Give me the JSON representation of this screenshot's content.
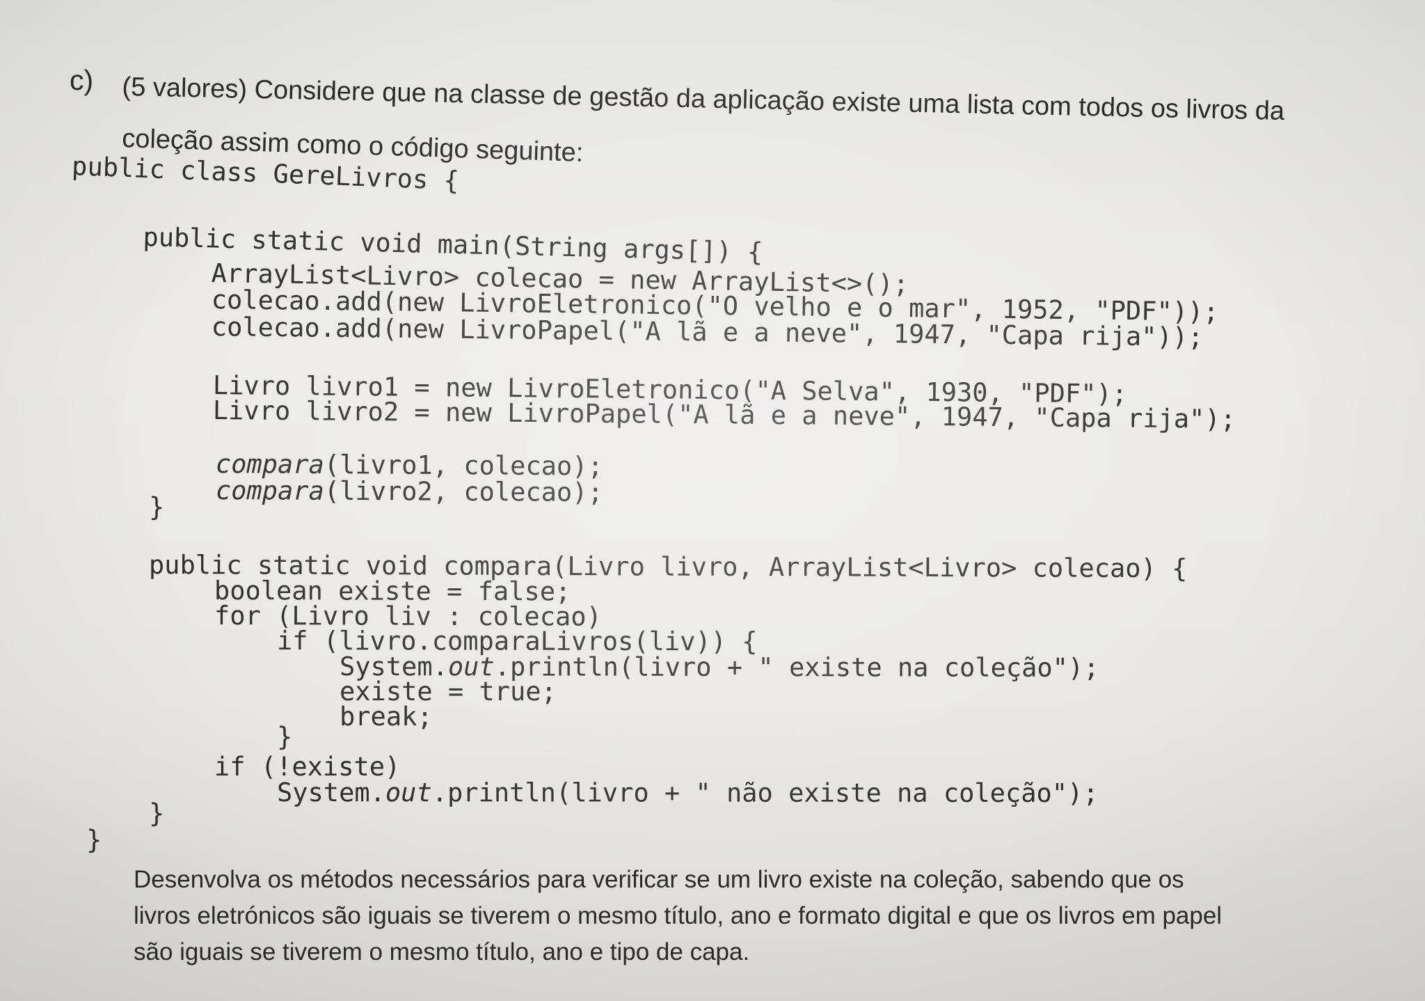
{
  "question": {
    "label": "c)",
    "intro_line1": "(5 valores) Considere que na classe de gestão da aplicação existe uma lista com todos os livros da",
    "intro_line2": "coleção assim como o código seguinte:"
  },
  "code": {
    "class_open": "public class GereLivros {",
    "main_sig": "public static void main(String args[]) {",
    "list_decl": "ArrayList<Livro> colecao = new ArrayList<>();",
    "add1": "colecao.add(new LivroEletronico(\"O velho e o mar\", 1952, \"PDF\"));",
    "add2": "colecao.add(new LivroPapel(\"A lã e a neve\", 1947, \"Capa rija\"));",
    "livro1": "Livro livro1 = new LivroEletronico(\"A Selva\", 1930, \"PDF\");",
    "livro2": "Livro livro2 = new LivroPapel(\"A lã e a neve\", 1947, \"Capa rija\");",
    "call_method": "compara",
    "call1_args": "(livro1, colecao);",
    "call2_args": "(livro2, colecao);",
    "close_main": "}",
    "compara_sig": "public static void compara(Livro livro, ArrayList<Livro> colecao) {",
    "bool_decl": "boolean existe = false;",
    "for_stmt": "for (Livro liv : colecao)",
    "if_stmt": "if (livro.comparaLivros(liv)) {",
    "print_exists_a": "System.",
    "out_field": "out",
    "print_exists_b": ".println(livro + \" existe na coleção\");",
    "assign_true": "existe = true;",
    "break_stmt": "break;",
    "close_if": "}",
    "if_not": "if (!existe)",
    "print_not_a": "System.",
    "print_not_b": ".println(livro + \" não existe na coleção\");",
    "close_compara": "}",
    "class_close": "}"
  },
  "paragraph": {
    "line1": "Desenvolva os métodos necessários para verificar se um livro existe na coleção, sabendo que os",
    "line2": "livros eletrónicos são iguais se tiverem o mesmo título, ano e formato digital e que os livros em papel",
    "line3": "são iguais se tiverem o mesmo título, ano e tipo de capa."
  }
}
